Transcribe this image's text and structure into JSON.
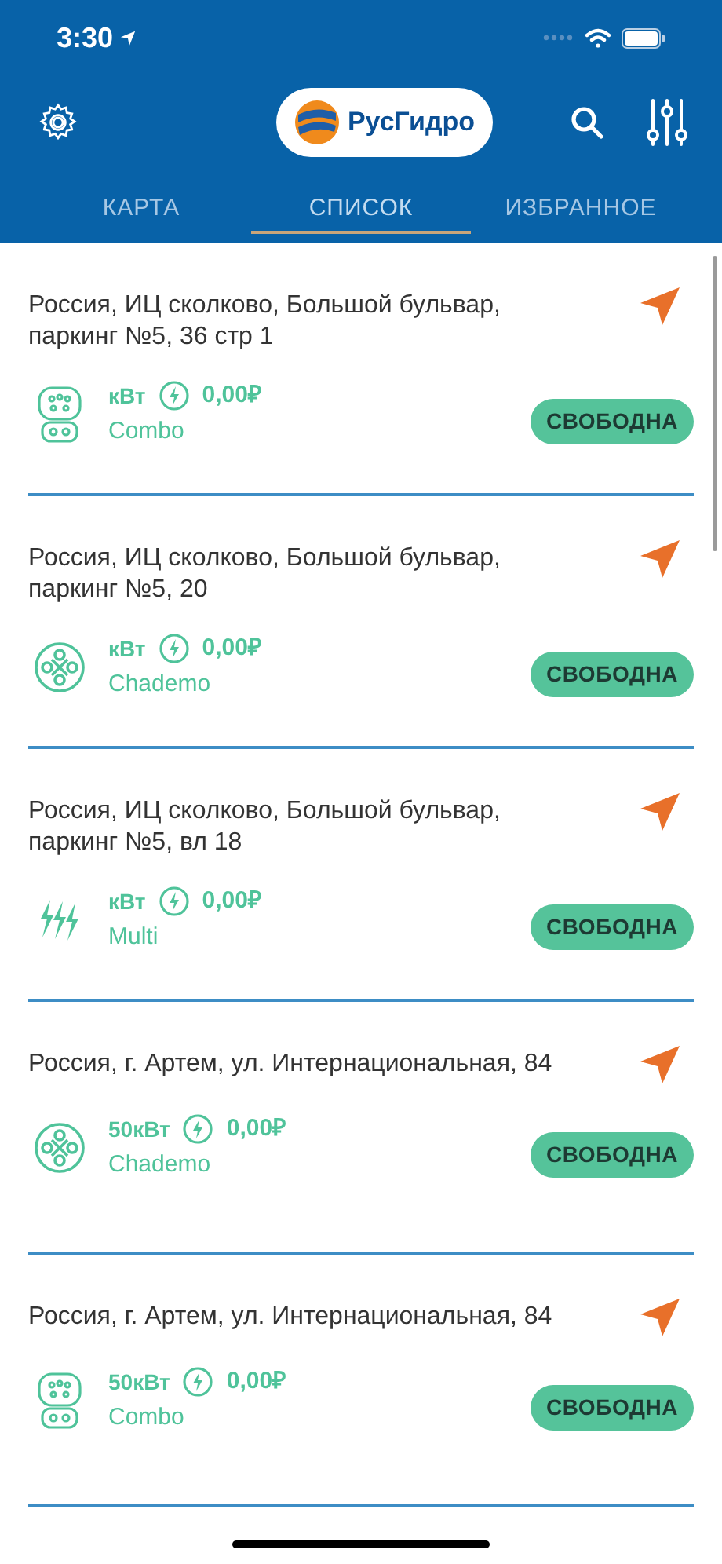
{
  "status_bar": {
    "time": "3:30"
  },
  "header": {
    "logo_text": "РусГидро"
  },
  "tabs": [
    {
      "label": "КАРТА",
      "selected": false
    },
    {
      "label": "СПИСОК",
      "selected": true
    },
    {
      "label": "ИЗБРАННОЕ",
      "selected": false
    }
  ],
  "stations": [
    {
      "address": "Россия, ИЦ сколково, Большой бульвар, паркинг №5, 36 стр 1",
      "power": "кВт",
      "price": "0,00₽",
      "connector": "Combo",
      "kind": "combo",
      "status": "СВОБОДНА"
    },
    {
      "address": "Россия, ИЦ сколково, Большой бульвар, паркинг №5, 20",
      "power": "кВт",
      "price": "0,00₽",
      "connector": "Chademo",
      "kind": "chademo",
      "status": "СВОБОДНА"
    },
    {
      "address": "Россия, ИЦ сколково, Большой бульвар, паркинг №5, вл 18",
      "power": "кВт",
      "price": "0,00₽",
      "connector": "Multi",
      "kind": "multi",
      "status": "СВОБОДНА"
    },
    {
      "address": "Россия, г. Артем, ул. Интернациональная, 84",
      "power": "50кВт",
      "price": "0,00₽",
      "connector": "Chademo",
      "kind": "chademo",
      "status": "СВОБОДНА"
    },
    {
      "address": "Россия, г. Артем, ул. Интернациональная, 84",
      "power": "50кВт",
      "price": "0,00₽",
      "connector": "Combo",
      "kind": "combo",
      "status": "СВОБОДНА"
    }
  ]
}
